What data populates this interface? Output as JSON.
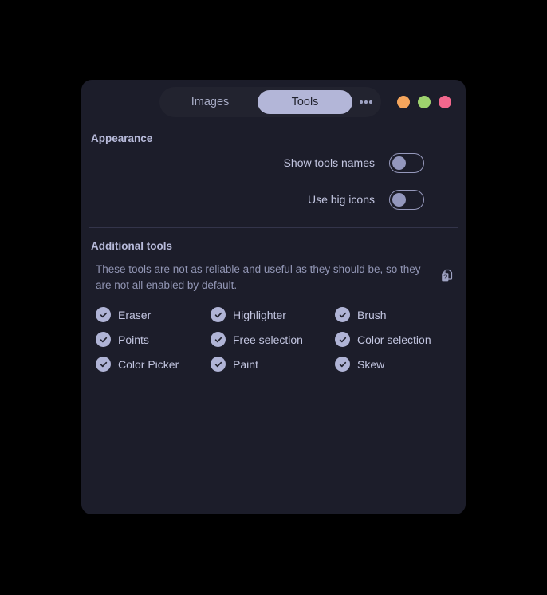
{
  "window": {
    "controls": [
      {
        "name": "minimize",
        "color": "#f5a55c"
      },
      {
        "name": "maximize",
        "color": "#9ed26e"
      },
      {
        "name": "close",
        "color": "#f2678d"
      }
    ],
    "overflow_label": "More options"
  },
  "tabs": [
    {
      "label": "Images",
      "active": false
    },
    {
      "label": "Tools",
      "active": true
    }
  ],
  "appearance": {
    "title": "Appearance",
    "settings": [
      {
        "label": "Show tools names",
        "enabled": false
      },
      {
        "label": "Use big icons",
        "enabled": false
      }
    ]
  },
  "additional_tools": {
    "title": "Additional tools",
    "description": "These tools are not as reliable and useful as they should be, so they are not all enabled by default.",
    "help_icon": "help-docs-icon",
    "tools": [
      {
        "label": "Eraser",
        "checked": true
      },
      {
        "label": "Highlighter",
        "checked": true
      },
      {
        "label": "Brush",
        "checked": true
      },
      {
        "label": "Points",
        "checked": true
      },
      {
        "label": "Free selection",
        "checked": true
      },
      {
        "label": "Color selection",
        "checked": true
      },
      {
        "label": "Color Picker",
        "checked": true
      },
      {
        "label": "Paint",
        "checked": true
      },
      {
        "label": "Skew",
        "checked": true
      }
    ]
  },
  "colors": {
    "card_background": "#1c1d2a",
    "page_background": "#000000",
    "accent": "#b3b6d8",
    "text_primary": "#c2c5e0",
    "text_muted": "#9296b5"
  }
}
